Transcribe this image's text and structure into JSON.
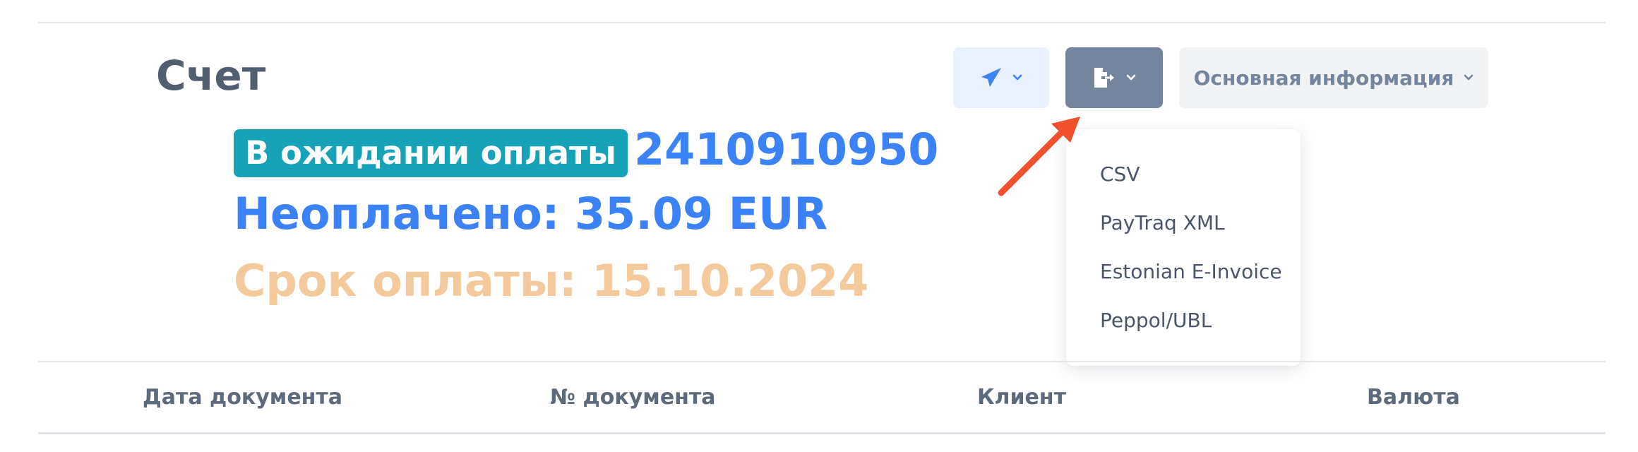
{
  "page": {
    "title": "Счет"
  },
  "invoice": {
    "status_badge": "В ожидании оплаты",
    "number": "2410910950",
    "unpaid_line": "Неоплачено: 35.09 EUR",
    "due_line": "Срок оплаты: 15.10.2024"
  },
  "toolbar": {
    "send_icon": "paper-plane-icon",
    "export_icon": "file-export-icon",
    "info_label": "Основная информация"
  },
  "export_menu": {
    "items": [
      {
        "label": "CSV"
      },
      {
        "label": "PayTraq XML"
      },
      {
        "label": "Estonian E-Invoice"
      },
      {
        "label": "Peppol/UBL"
      }
    ]
  },
  "table": {
    "headers": [
      "Дата документа",
      "№ документа",
      "Клиент",
      "Валюта"
    ]
  },
  "colors": {
    "accent_blue": "#3b82f6",
    "status_teal": "#17a2b8",
    "due_orange": "#f4c99b",
    "annotation_arrow": "#f0502d"
  }
}
